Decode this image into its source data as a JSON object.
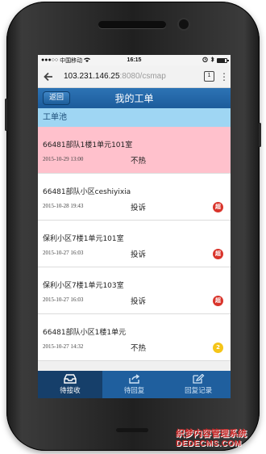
{
  "status_bar": {
    "carrier": "中国移动",
    "time": "16:15",
    "battery_level": 0.85
  },
  "browser": {
    "url_host": "103.231.146.25",
    "url_path": ":8080/csmap",
    "tab_count": "1"
  },
  "header": {
    "back_label": "返回",
    "title": "我的工单"
  },
  "section": {
    "title": "工单池"
  },
  "orders": [
    {
      "address": "66481部队1楼1单元101室",
      "date": "2015-10-29 13:00",
      "type": "不热",
      "badge": "",
      "badge_color": "",
      "highlighted": true
    },
    {
      "address": "66481部队小区ceshiyixia",
      "date": "2015-10-28 19:43",
      "type": "投诉",
      "badge": "超",
      "badge_color": "#d9342b",
      "highlighted": false
    },
    {
      "address": "保利小区7楼1单元101室",
      "date": "2015-10-27 16:03",
      "type": "投诉",
      "badge": "超",
      "badge_color": "#d9342b",
      "highlighted": false
    },
    {
      "address": "保利小区7楼1单元103室",
      "date": "2015-10-27 16:03",
      "type": "投诉",
      "badge": "超",
      "badge_color": "#d9342b",
      "highlighted": false
    },
    {
      "address": "66481部队小区1楼1单元",
      "date": "2015-10-27 14:32",
      "type": "不热",
      "badge": "2",
      "badge_color": "#f5c518",
      "highlighted": false
    }
  ],
  "tabs": [
    {
      "label": "待接收",
      "icon": "inbox-icon",
      "active": true
    },
    {
      "label": "待回复",
      "icon": "reply-icon",
      "active": false
    },
    {
      "label": "回复记录",
      "icon": "edit-icon",
      "active": false
    }
  ],
  "watermark": {
    "line1": "织梦内容管理系统",
    "line2": "DEDECMS.COM"
  },
  "colors": {
    "header_blue": "#1c5c9b",
    "section_blue": "#9fd6f3",
    "highlight_pink": "#ffc1cc",
    "badge_red": "#d9342b",
    "badge_yellow": "#f5c518"
  }
}
